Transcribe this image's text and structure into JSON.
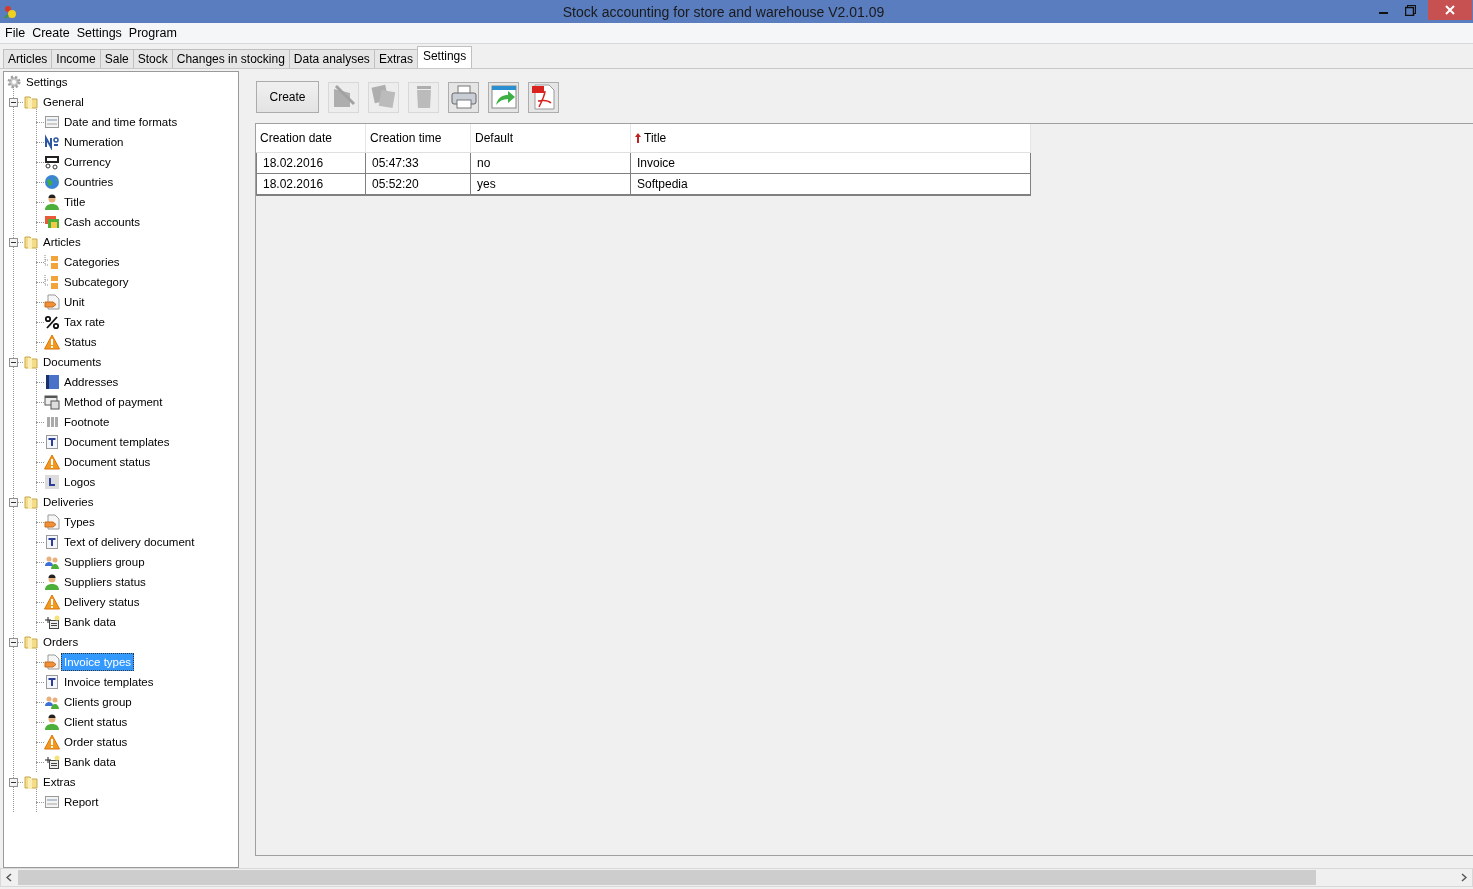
{
  "window": {
    "title": "Stock accounting for store and warehouse V2.01.09"
  },
  "menu": [
    "File",
    "Create",
    "Settings",
    "Program"
  ],
  "tabs": [
    {
      "label": "Articles",
      "selected": false
    },
    {
      "label": "Income",
      "selected": false
    },
    {
      "label": "Sale",
      "selected": false
    },
    {
      "label": "Stock",
      "selected": false
    },
    {
      "label": "Changes in stocking",
      "selected": false
    },
    {
      "label": "Data analyses",
      "selected": false
    },
    {
      "label": "Extras",
      "selected": false
    },
    {
      "label": "Settings",
      "selected": true
    }
  ],
  "tree": {
    "label": "Settings",
    "kind": "gear",
    "selected": false,
    "children": [
      {
        "label": "General",
        "kind": "folder",
        "expanded": true,
        "selected": false,
        "children": [
          {
            "label": "Date and time formats",
            "kind": "form",
            "selected": false
          },
          {
            "label": "Numeration",
            "kind": "number",
            "selected": false
          },
          {
            "label": "Currency",
            "kind": "currency",
            "selected": false
          },
          {
            "label": "Countries",
            "kind": "globe",
            "selected": false
          },
          {
            "label": "Title",
            "kind": "person",
            "selected": false
          },
          {
            "label": "Cash accounts",
            "kind": "cash",
            "selected": false
          }
        ]
      },
      {
        "label": "Articles",
        "kind": "folder",
        "expanded": true,
        "selected": false,
        "children": [
          {
            "label": "Categories",
            "kind": "subfolder",
            "selected": false
          },
          {
            "label": "Subcategory",
            "kind": "subfolder",
            "selected": false
          },
          {
            "label": "Unit",
            "kind": "tag",
            "selected": false
          },
          {
            "label": "Tax rate",
            "kind": "percent",
            "selected": false
          },
          {
            "label": "Status",
            "kind": "warning",
            "selected": false
          }
        ]
      },
      {
        "label": "Documents",
        "kind": "folder",
        "expanded": true,
        "selected": false,
        "children": [
          {
            "label": "Addresses",
            "kind": "book",
            "selected": false
          },
          {
            "label": "Method of payment",
            "kind": "payment",
            "selected": false
          },
          {
            "label": "Footnote",
            "kind": "columns",
            "selected": false
          },
          {
            "label": "Document templates",
            "kind": "text",
            "selected": false
          },
          {
            "label": "Document status",
            "kind": "warning",
            "selected": false
          },
          {
            "label": "Logos",
            "kind": "logo",
            "selected": false
          }
        ]
      },
      {
        "label": "Deliveries",
        "kind": "folder",
        "expanded": true,
        "selected": false,
        "children": [
          {
            "label": "Types",
            "kind": "tag",
            "selected": false
          },
          {
            "label": "Text of delivery document",
            "kind": "text",
            "selected": false
          },
          {
            "label": "Suppliers group",
            "kind": "people",
            "selected": false
          },
          {
            "label": "Suppliers status",
            "kind": "person",
            "selected": false
          },
          {
            "label": "Delivery status",
            "kind": "warning",
            "selected": false
          },
          {
            "label": "Bank data",
            "kind": "bank",
            "selected": false
          }
        ]
      },
      {
        "label": "Orders",
        "kind": "folder",
        "expanded": true,
        "selected": false,
        "children": [
          {
            "label": "Invoice types",
            "kind": "tag",
            "selected": true
          },
          {
            "label": "Invoice templates",
            "kind": "text",
            "selected": false
          },
          {
            "label": "Clients group",
            "kind": "people",
            "selected": false
          },
          {
            "label": "Client status",
            "kind": "person",
            "selected": false
          },
          {
            "label": "Order status",
            "kind": "warning",
            "selected": false
          },
          {
            "label": "Bank data",
            "kind": "bank",
            "selected": false
          }
        ]
      },
      {
        "label": "Extras",
        "kind": "folder",
        "expanded": true,
        "selected": false,
        "children": [
          {
            "label": "Report",
            "kind": "form",
            "selected": false
          }
        ]
      }
    ]
  },
  "toolbar": {
    "create_label": "Create",
    "buttons": [
      {
        "kind": "edit",
        "disabled": true
      },
      {
        "kind": "copy",
        "disabled": true
      },
      {
        "kind": "delete",
        "disabled": true
      },
      {
        "kind": "print",
        "disabled": false
      },
      {
        "kind": "export",
        "disabled": false
      },
      {
        "kind": "pdf",
        "disabled": false
      }
    ]
  },
  "table": {
    "columns": [
      {
        "label": "Creation date",
        "sorted": false
      },
      {
        "label": "Creation time",
        "sorted": false
      },
      {
        "label": "Default",
        "sorted": false
      },
      {
        "label": "Title",
        "sorted": true
      }
    ],
    "rows": [
      [
        "18.02.2016",
        "05:47:33",
        "no",
        "Invoice"
      ],
      [
        "18.02.2016",
        "05:52:20",
        "yes",
        "Softpedia"
      ]
    ]
  }
}
